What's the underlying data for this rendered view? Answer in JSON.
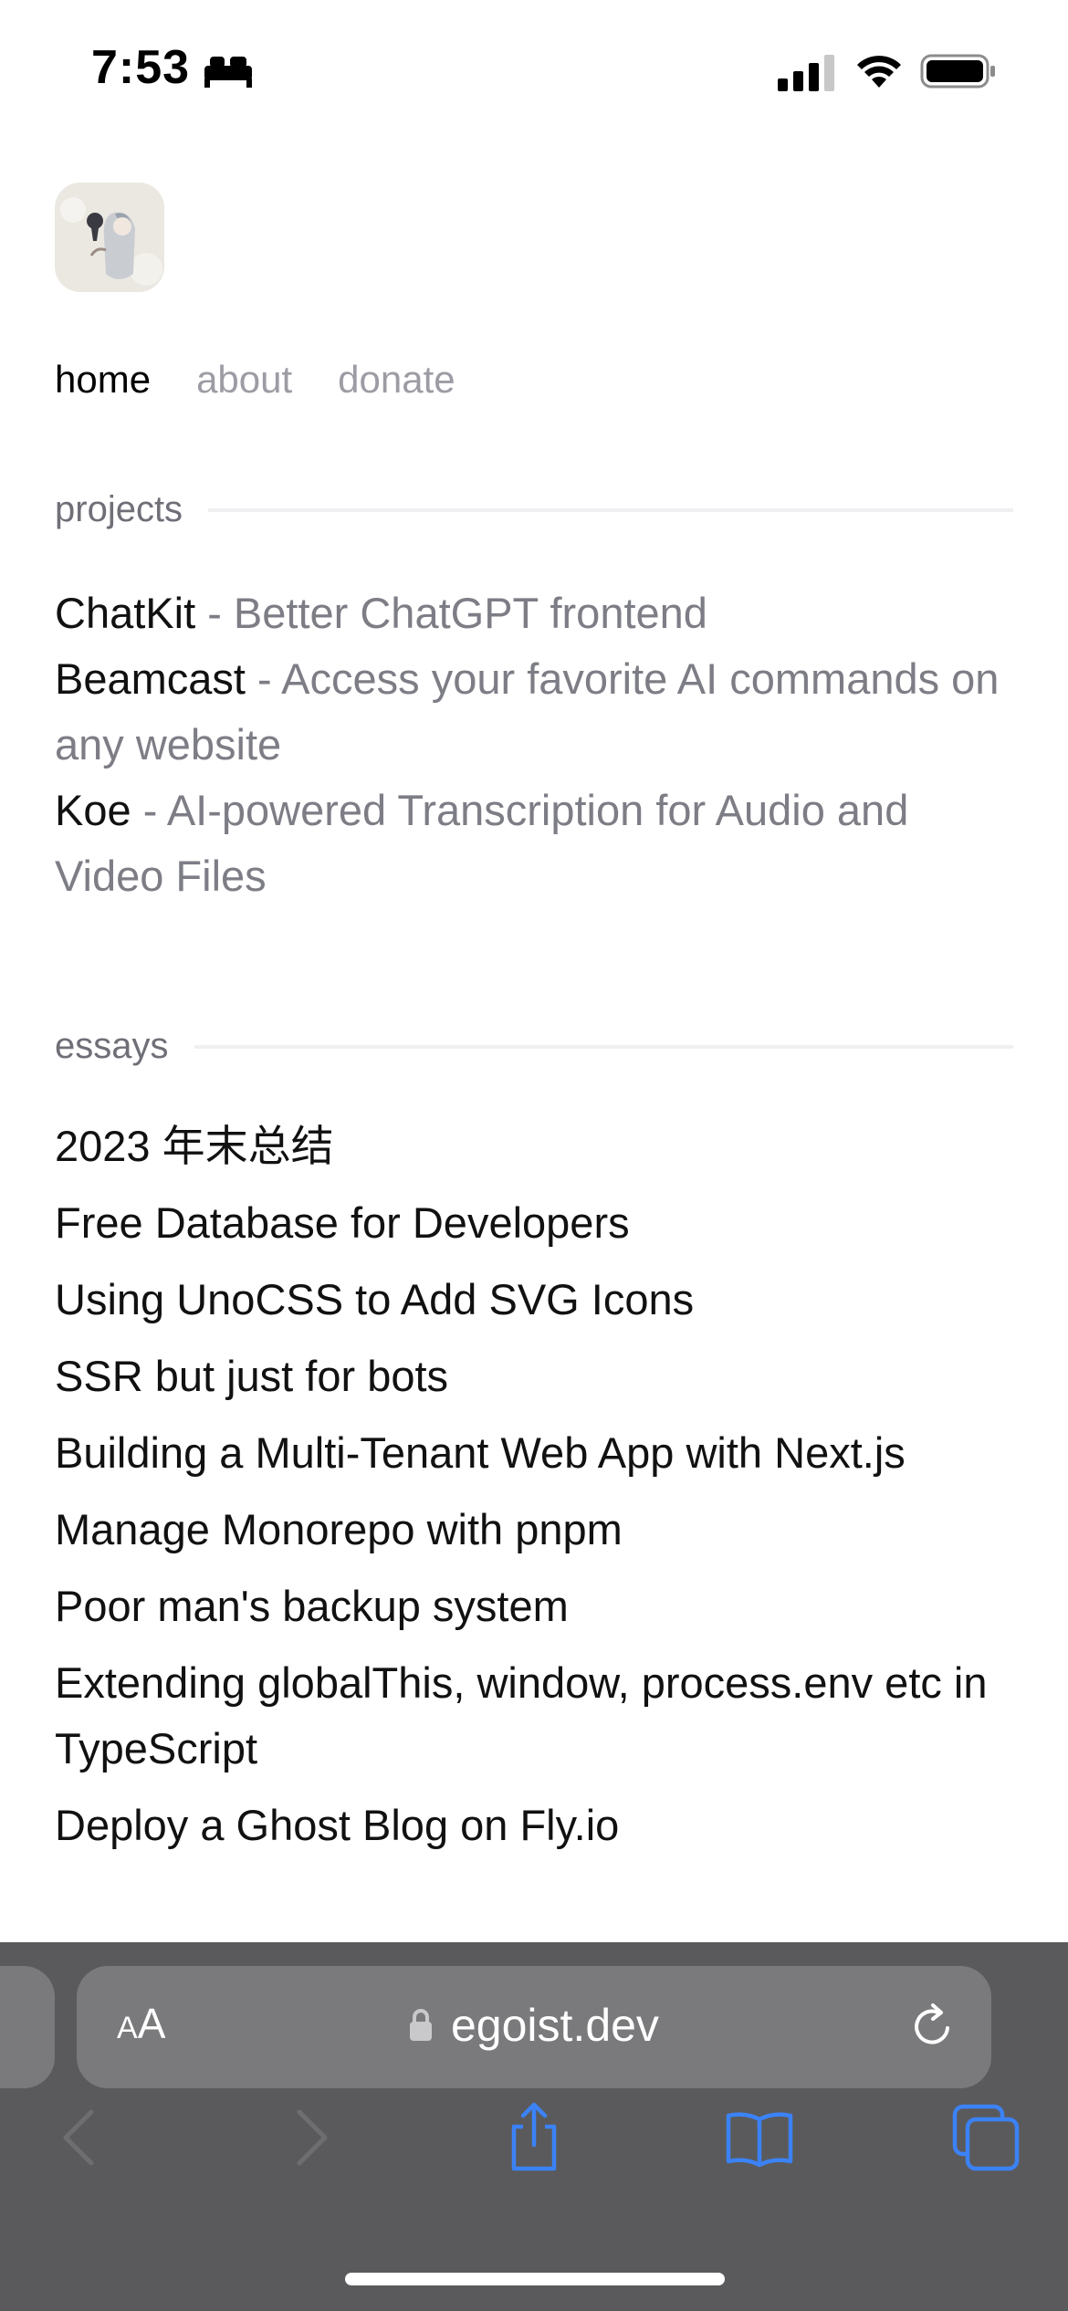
{
  "status_bar": {
    "time": "7:53",
    "focus_icon": "bed-icon",
    "signal_icon": "cellular-signal-icon",
    "wifi_icon": "wifi-icon",
    "battery_icon": "battery-icon"
  },
  "nav": {
    "home": "home",
    "about": "about",
    "donate": "donate"
  },
  "projects": {
    "heading": "projects",
    "items": [
      {
        "name": "ChatKit",
        "desc": " - Better ChatGPT frontend"
      },
      {
        "name": "Beamcast",
        "desc": " - Access your favorite AI commands on any website"
      },
      {
        "name": "Koe",
        "desc": " - AI-powered Transcription for Audio and Video Files"
      }
    ]
  },
  "essays": {
    "heading": "essays",
    "items": [
      "2023 年末总结",
      "Free Database for Developers",
      "Using UnoCSS to Add SVG Icons",
      "SSR but just for bots",
      "Building a Multi-Tenant Web App with Next.js",
      "Manage Monorepo with pnpm",
      "Poor man's backup system",
      "Extending globalThis, window, process.env etc in TypeScript",
      "Deploy a Ghost Blog on Fly.io"
    ]
  },
  "browser": {
    "text_size_big": "A",
    "text_size_small": "A",
    "url": "egoist.dev",
    "accent_color": "#3b82f6"
  }
}
